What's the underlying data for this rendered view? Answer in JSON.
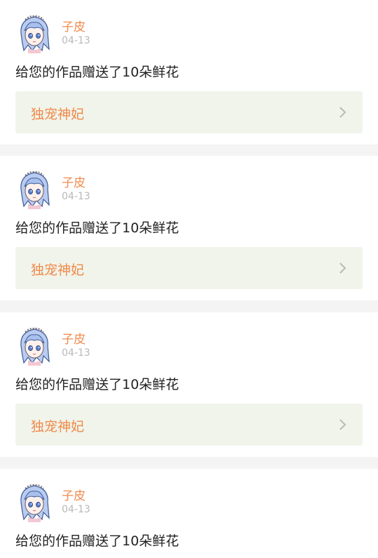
{
  "notifications": [
    {
      "username": "子皮",
      "date": "04-13",
      "message": "给您的作品赠送了10朵鲜花",
      "work_title": "独宠神妃",
      "avatar_icon": "anime-girl-avatar-icon",
      "chevron_icon": "chevron-right-icon"
    },
    {
      "username": "子皮",
      "date": "04-13",
      "message": "给您的作品赠送了10朵鲜花",
      "work_title": "独宠神妃",
      "avatar_icon": "anime-girl-avatar-icon",
      "chevron_icon": "chevron-right-icon"
    },
    {
      "username": "子皮",
      "date": "04-13",
      "message": "给您的作品赠送了10朵鲜花",
      "work_title": "独宠神妃",
      "avatar_icon": "anime-girl-avatar-icon",
      "chevron_icon": "chevron-right-icon"
    },
    {
      "username": "子皮",
      "date": "04-13",
      "message": "给您的作品赠送了10朵鲜花",
      "avatar_icon": "anime-girl-avatar-icon"
    }
  ],
  "colors": {
    "accent": "#f08a4b",
    "date_gray": "#b8b8b8",
    "link_background": "#f1f4ea",
    "separator": "#f4f4f4",
    "card_background": "#ffffff"
  }
}
